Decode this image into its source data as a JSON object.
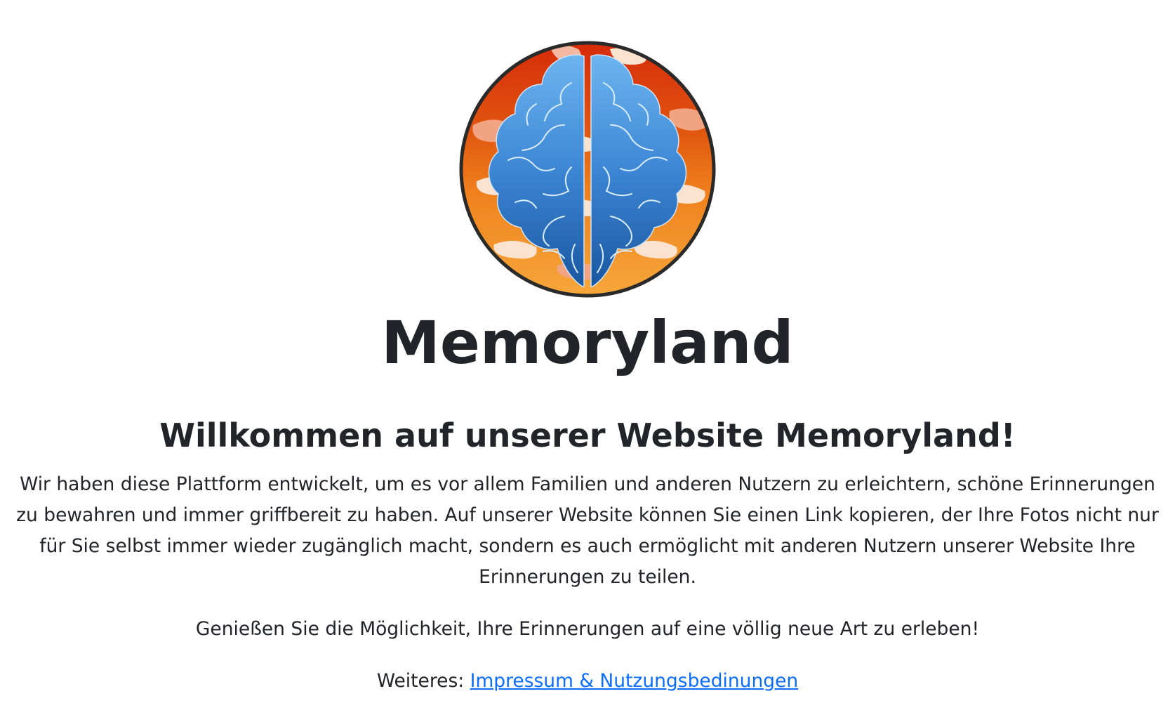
{
  "site": {
    "title": "Memoryland"
  },
  "logo": {
    "icon": "brain-logo-icon",
    "colors": {
      "brain_light": "#5ea8ea",
      "brain_dark": "#1f5fa8",
      "bg_red": "#d62a0a",
      "bg_orange": "#f0821e",
      "bg_yellow": "#f6a83a",
      "bg_pale": "#fbe3d0",
      "border": "#2a2a2a"
    }
  },
  "content": {
    "welcome_heading": "Willkommen auf unserer Website Memoryland!",
    "intro_text": "Wir haben diese Plattform entwickelt, um es vor allem Familien und anderen Nutzern zu erleichtern, schöne Erinnerungen zu bewahren und immer griffbereit zu haben. Auf unserer Website können Sie einen Link kopieren, der Ihre Fotos nicht nur für Sie selbst immer wieder zugänglich macht, sondern es auch ermöglicht mit anderen Nutzern unserer Website Ihre Erinnerungen zu teilen.",
    "enjoy_text": "Genießen Sie die Möglichkeit, Ihre Erinnerungen auf eine völlig neue Art zu erleben!",
    "more_label": "Weiteres:",
    "imprint_link": "Impressum & Nutzungsbedinungen"
  },
  "colors": {
    "text": "#212529",
    "link": "#0d6efd",
    "background": "#ffffff"
  }
}
